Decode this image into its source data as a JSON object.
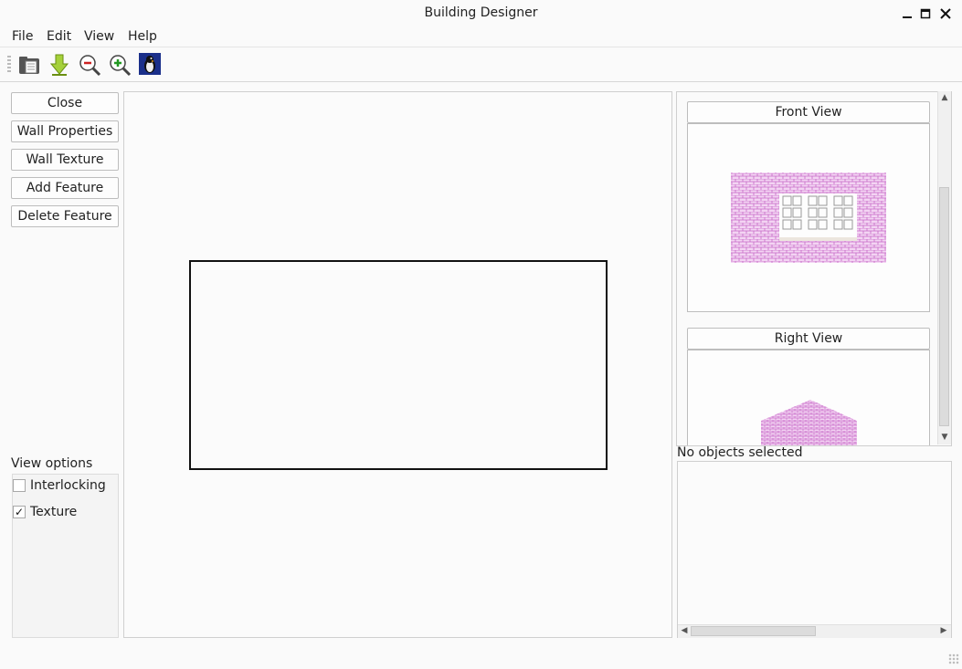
{
  "window": {
    "title": "Building Designer"
  },
  "menu": {
    "items": [
      "File",
      "Edit",
      "View",
      "Help"
    ]
  },
  "toolbar": {
    "icons": [
      "open-folder-icon",
      "download-icon",
      "zoom-out-icon",
      "zoom-in-icon",
      "penguin-icon"
    ]
  },
  "sidebar": {
    "buttons": [
      "Close",
      "Wall Properties",
      "Wall Texture",
      "Add Feature",
      "Delete Feature"
    ]
  },
  "view_options": {
    "label": "View options",
    "items": [
      {
        "label": "Interlocking",
        "checked": false,
        "mark": ""
      },
      {
        "label": "Texture",
        "checked": true,
        "mark": "✓"
      }
    ]
  },
  "preview": {
    "front_label": "Front View",
    "right_label": "Right View",
    "wall_color": "#cc77cc"
  },
  "status": {
    "text": "No objects selected"
  }
}
